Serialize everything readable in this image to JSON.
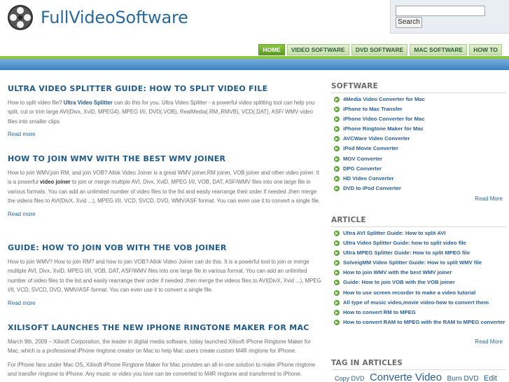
{
  "site": {
    "name": "FullVideoSoftware"
  },
  "search": {
    "placeholder": "",
    "button_label": "Search"
  },
  "nav": [
    {
      "label": "HOME",
      "active": true
    },
    {
      "label": "VIDEO SOFTWARE"
    },
    {
      "label": "DVD SOFTWARE"
    },
    {
      "label": "MAC SOFTWARE"
    },
    {
      "label": "HOW TO"
    }
  ],
  "posts": [
    {
      "title": "ULTRA VIDEO SPLITTER GUIDE: HOW TO SPLIT VIDEO FILE",
      "body_pre": "How to split video file?  ",
      "body_link": "Ultra Video Splitter",
      "body_post": " can do this for you. Ultra Video Splitter - a powerful video splitting tool can help you split, cut or trim large AVI(Divx, XviD, MPEG4), MPEG I/II, DVD(.VOB), RealMedia(.RM,.RMVB), VCD(.DAT), ASF/ WMV video files into smaller clips.",
      "read_more": "Read more"
    },
    {
      "title": "HOW TO JOIN WMV WITH THE BEST WMV JOINER",
      "body_pre": "How to join WMV,join RM, and join VOB? Allok Video Joiner is a great WMV joiner,RM joiner, VOB joiner and other video joiner. It is a powerful ",
      "body_bold": "video joiner",
      "body_post": " to join or merge multiple AVI, Divx, XviD, MPEG I/II, VOB, DAT, ASF/WMV files into one large file in various formats. You can add an unlimited number of video files to the list and easily rearrange their order if needed ,then merge the videos files to AVI(DivX, Xvid ...), MPEG I/II, VCD, SVCD, DVD, WMV/ASF format. You can even use it to convert a single file.",
      "read_more": "Read more"
    },
    {
      "title": "GUIDE: HOW TO JOIN VOB WITH THE VOB JOINER",
      "body": "How to join WMV? How to join RM? and how to join VOB? Allok Video Joiner can do this. It is a powerful tool to join or merge multiple AVI, Divx, XviD, MPEG I/II, VOB, DAT, ASF/WMV files into one large file in various format. You can add an unlimited number of video files to the list and easily rearrange their order if needed ,then merge the videos files to AVI(DivX, Xvid ...), MPEG I/II, VCD, SVCD, DVD, WMV/ASF format. You can even use it to convert a single file.",
      "read_more": "Read more"
    },
    {
      "title": "XILISOFT LAUNCHES THE NEW IPHONE RINGTONE MAKER FOR MAC",
      "body": "March 9th, 2009 – Xilisoft Corporation, the leader in digital media software, today launched Xilisoft iPhone Ringtone Maker for Mac, which is a professional iPhone ringtone creator on Mac to help Mac users create custom M4R ringtone for iPhone.",
      "body2": "For iPhone fans under Mac OS, Xilisoft iPhone Ringtone Maker for Mac provides an all-in-one solution to make iPhone ringtone and transfer ringtone to iPhone. Any music or video you love can be converted to M4R ringtone and transferred to iPhone."
    }
  ],
  "sidebar": {
    "software": {
      "heading": "SOFTWARE",
      "items": [
        "4Media Video Converter for Mac",
        "iPhone to Mac Transfer",
        "iPhone Video Converter for Mac",
        "iPhone Ringtone Maker for Mac",
        "AVCWare Video Converter",
        "iPod Movie Converter",
        "MOV Converter",
        "DPG Converter",
        "HD Video Converter",
        "DVD to iPod Converter"
      ],
      "read_more": "Read More"
    },
    "article": {
      "heading": "ARTICLE",
      "items": [
        "Ultra AVI Splitter Guide: How to split AVI",
        "Ultra Video Splitter Guide: how to split video file",
        "Ultra MPEG Splitter Guide: How to split MPEG file",
        "SolveigMM Video Splitter Guide: How to split WMV file",
        "How to join WMV with the best WMV joiner",
        "Guide: How to join VOB with the VOB joiner",
        "How to use screen recorder to make a video tutorial",
        "All type of music video,movie video-how to convert them",
        "How to convert RM to MPEG",
        "How to convert RAM to MPEG with the RAM to MPEG converter"
      ],
      "read_more": "Read More"
    },
    "tags": {
      "heading": "TAG IN ARTICLES",
      "items": [
        {
          "label": "Copy DVD",
          "size": "small"
        },
        {
          "label": "Converte Video",
          "size": "large"
        },
        {
          "label": "Burn DVD",
          "size": "medium"
        },
        {
          "label": "Edit",
          "size": "medium"
        }
      ]
    }
  }
}
